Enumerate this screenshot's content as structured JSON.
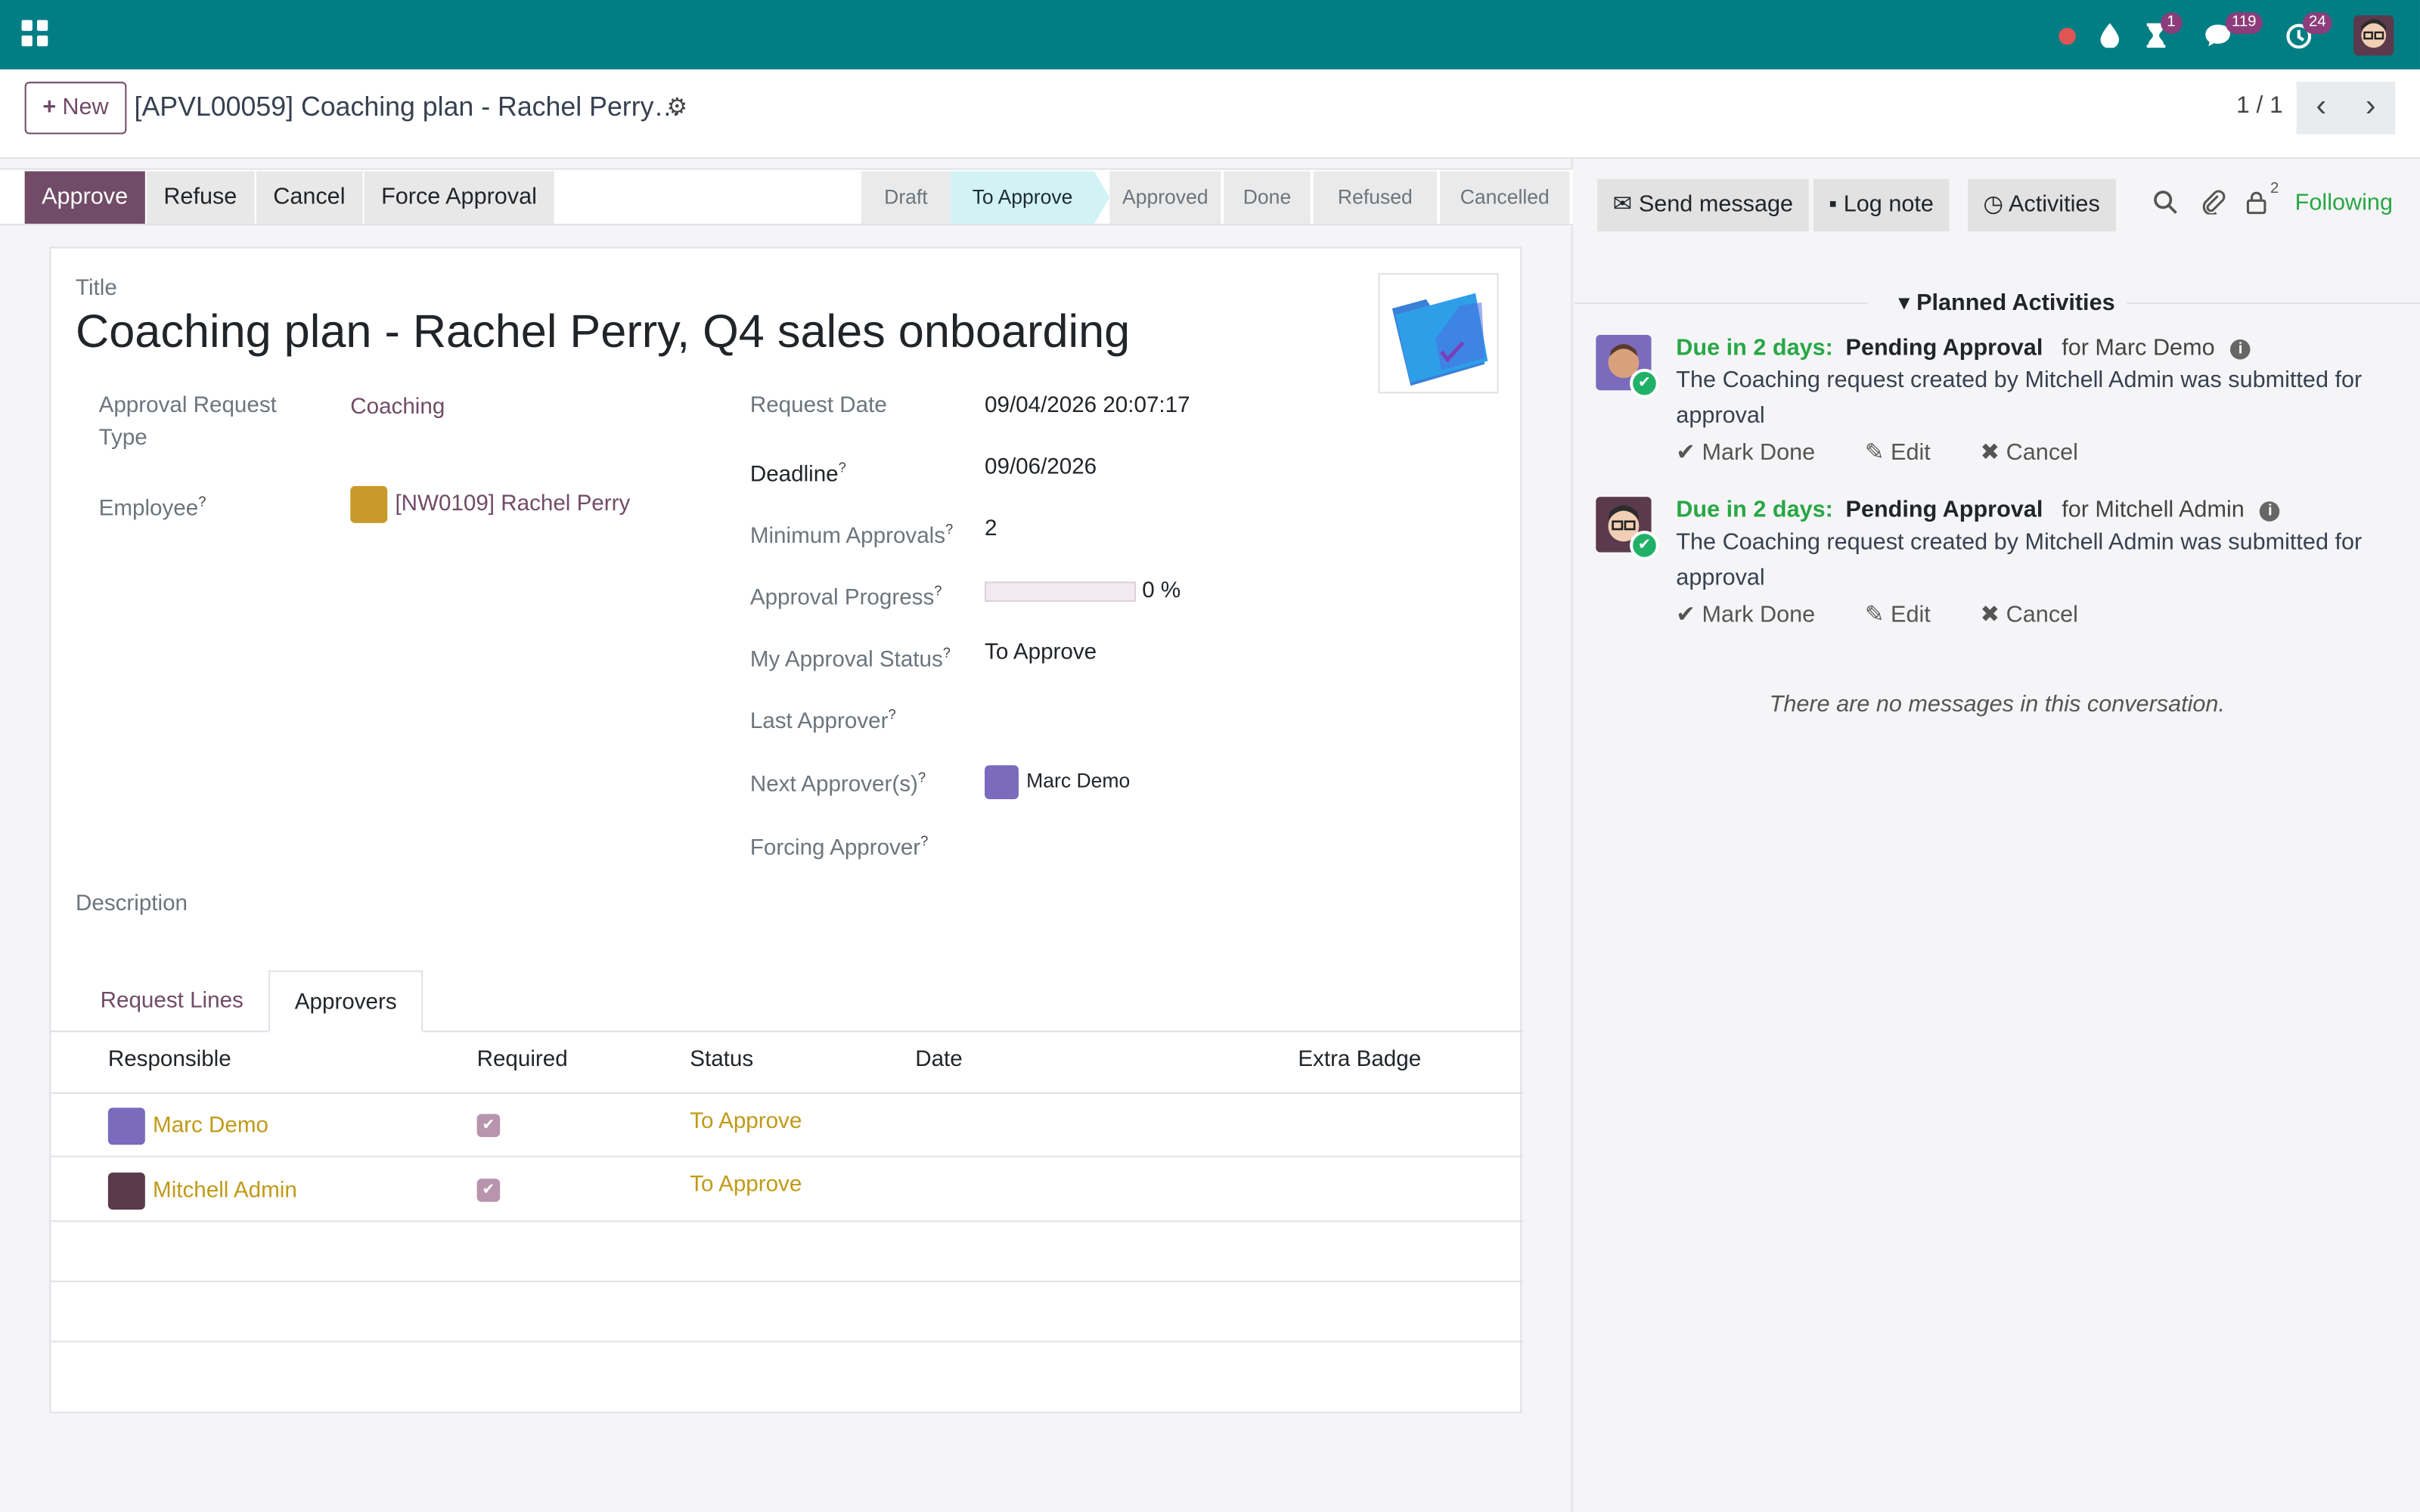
{
  "navbar": {
    "icons": [
      "apps-icon",
      "recording-dot-icon",
      "droplet-icon",
      "hourglass-icon",
      "chat-icon",
      "clock-icon"
    ],
    "badges": {
      "activities": "1",
      "messages": "119",
      "clock": "24"
    },
    "color": "#017e84"
  },
  "control": {
    "new_label": "New",
    "record_title": "[APVL00059] Coaching plan - Rachel Perry…",
    "pager": "1 / 1"
  },
  "statusbar": {
    "buttons": [
      "Approve",
      "Refuse",
      "Cancel",
      "Force Approval"
    ],
    "stages": [
      "Draft",
      "To Approve",
      "Approved",
      "Done",
      "Refused",
      "Cancelled"
    ],
    "current_stage": "To Approve"
  },
  "form": {
    "title_label": "Title",
    "title": "Coaching plan - Rachel Perry, Q4 sales onboarding",
    "left_fields": {
      "type_label_1": "Approval Request",
      "type_label_2": "Type",
      "type_value": "Coaching",
      "employee_label": "Employee",
      "employee_value": "[NW0109] Rachel Perry"
    },
    "right_fields": {
      "request_date_label": "Request Date",
      "request_date": "09/04/2026 20:07:17",
      "deadline_label": "Deadline",
      "deadline": "09/06/2026",
      "min_approvals_label": "Minimum Approvals",
      "min_approvals": "2",
      "progress_label": "Approval Progress",
      "progress_text": "0 %",
      "progress_fraction": 0,
      "my_status_label": "My Approval Status",
      "my_status": "To Approve",
      "last_approver_label": "Last Approver",
      "next_approver_label": "Next Approver(s)",
      "next_approver": "Marc Demo",
      "forcing_approver_label": "Forcing Approver"
    },
    "help_mark": "?",
    "description_label": "Description",
    "tabs": [
      "Request Lines",
      "Approvers"
    ],
    "active_tab": "Approvers",
    "table": {
      "columns": [
        "Responsible",
        "Required",
        "Status",
        "Date",
        "Extra Badge"
      ],
      "rows": [
        {
          "responsible": "Marc Demo",
          "required": true,
          "status": "To Approve",
          "date": "",
          "extra": ""
        },
        {
          "responsible": "Mitchell Admin",
          "required": true,
          "status": "To Approve",
          "date": "",
          "extra": ""
        }
      ]
    }
  },
  "chatter": {
    "send_message": "Send message",
    "log_note": "Log note",
    "activities": "Activities",
    "followers_count": "2",
    "following": "Following",
    "planned_title": "Planned Activities",
    "activities_list": [
      {
        "due": "Due in 2 days:",
        "type": "Pending Approval",
        "for": "for Marc Demo",
        "desc": "The Coaching request created by Mitchell Admin was submitted for approval"
      },
      {
        "due": "Due in 2 days:",
        "type": "Pending Approval",
        "for": "for Mitchell Admin",
        "desc": "The Coaching request created by Mitchell Admin was submitted for approval"
      }
    ],
    "actions": [
      "Mark Done",
      "Edit",
      "Cancel"
    ],
    "no_messages": "There are no messages in this conversation."
  }
}
